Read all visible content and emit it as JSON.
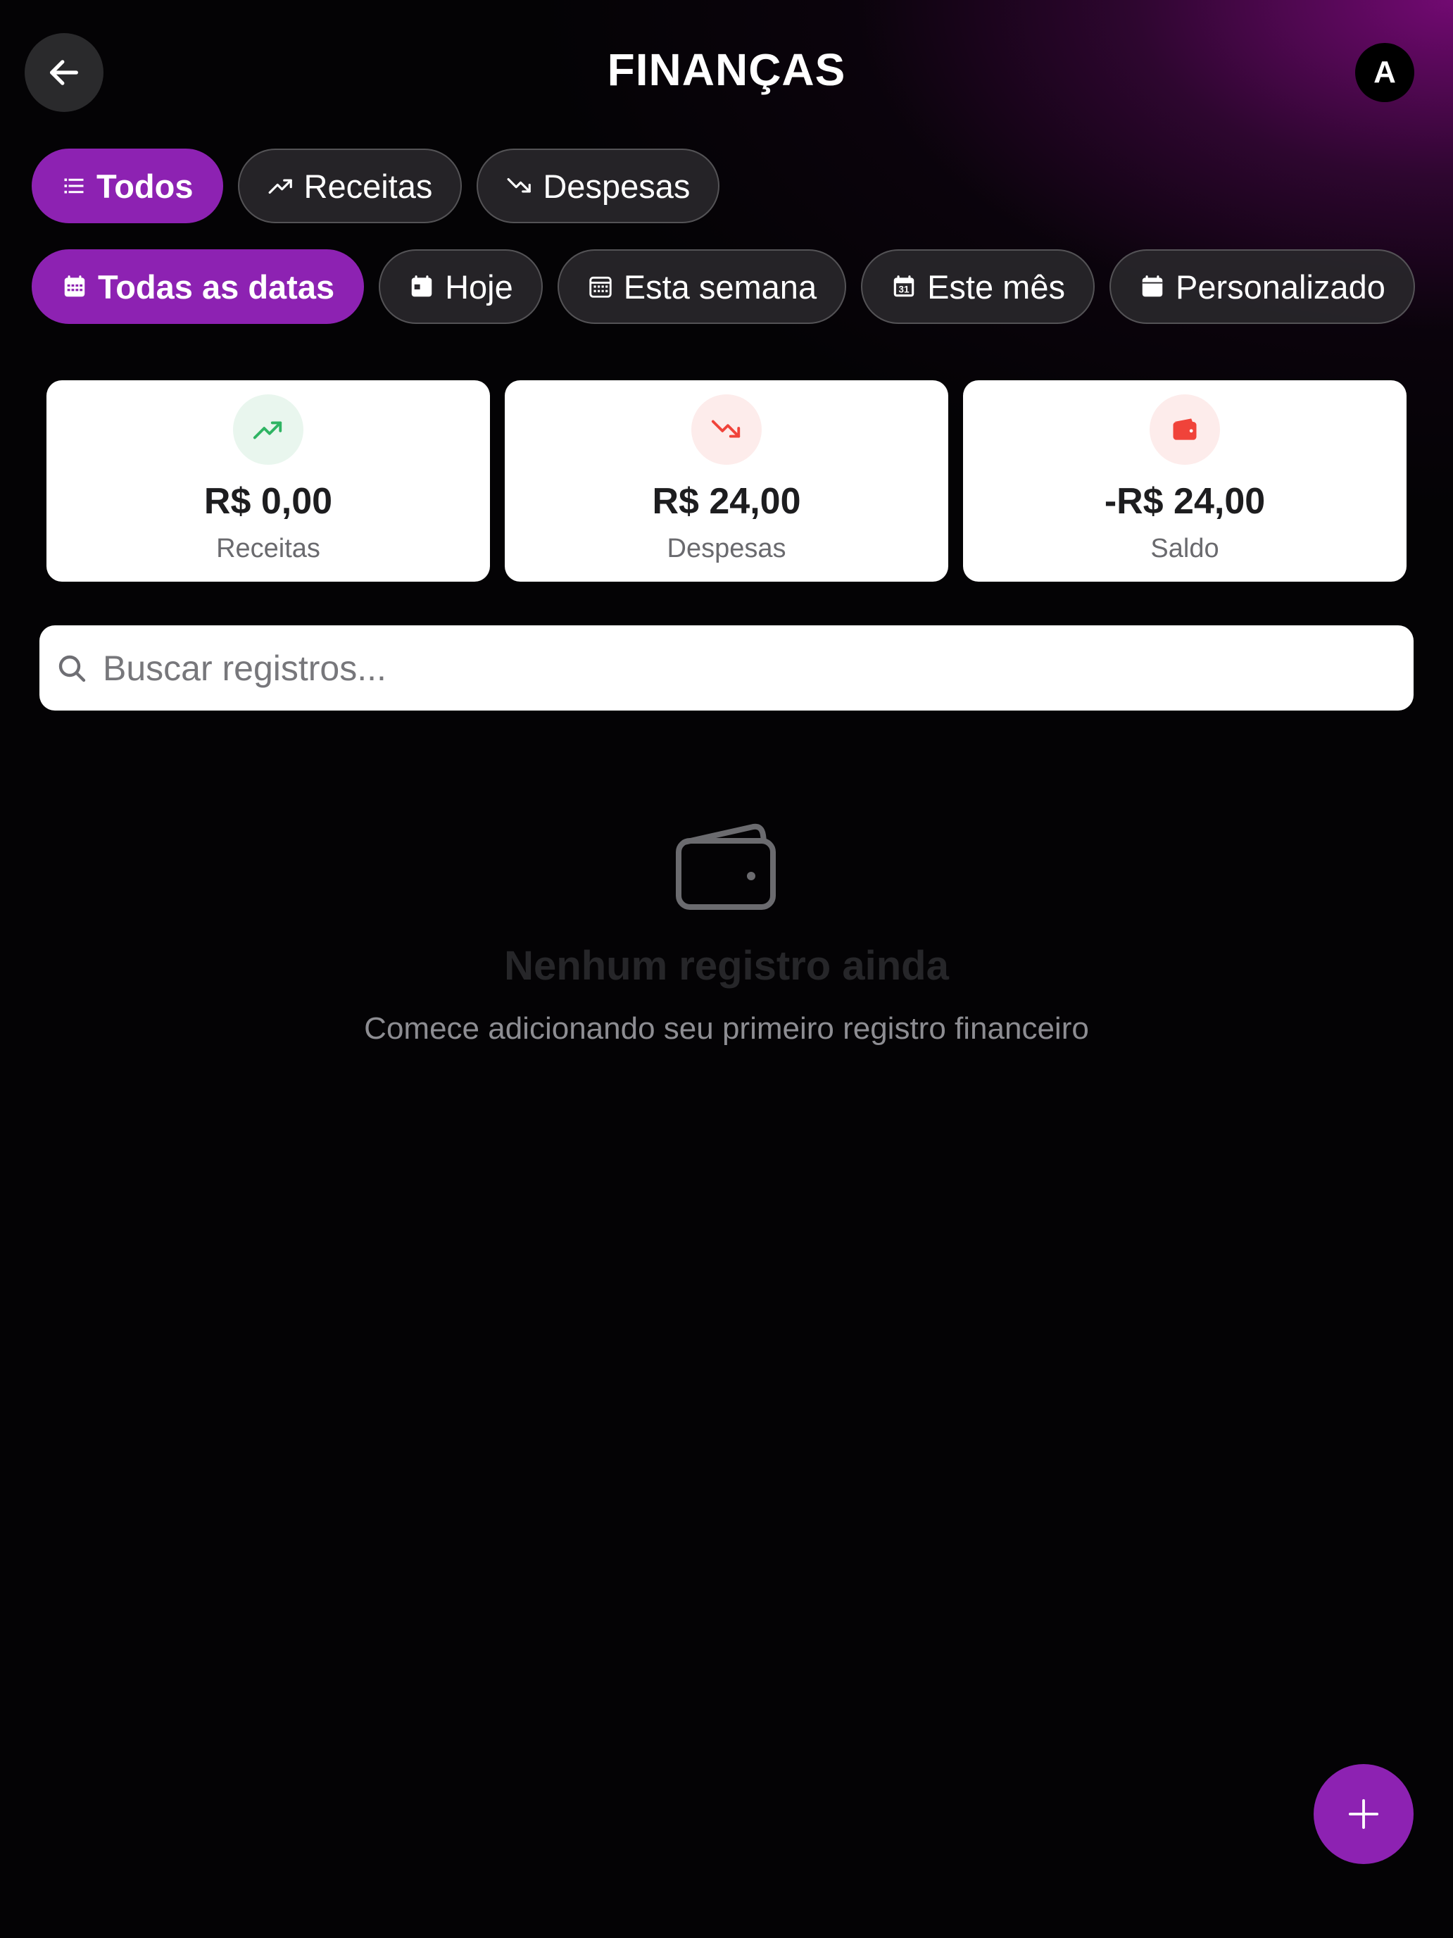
{
  "header": {
    "title": "FINANÇAS",
    "avatar_initial": "A"
  },
  "type_filters": [
    {
      "label": "Todos",
      "icon": "list-icon",
      "active": true
    },
    {
      "label": "Receitas",
      "icon": "trending-up-icon",
      "active": false
    },
    {
      "label": "Despesas",
      "icon": "trending-down-icon",
      "active": false
    }
  ],
  "date_filters": [
    {
      "label": "Todas as datas",
      "icon": "calendar-grid-icon",
      "active": true
    },
    {
      "label": "Hoje",
      "icon": "calendar-today-icon",
      "active": false
    },
    {
      "label": "Esta semana",
      "icon": "calendar-week-icon",
      "active": false
    },
    {
      "label": "Este mês",
      "icon": "calendar-month-icon",
      "active": false
    },
    {
      "label": "Personalizado",
      "icon": "calendar-custom-icon",
      "active": false
    }
  ],
  "summary": {
    "income": {
      "amount": "R$ 0,00",
      "label": "Receitas",
      "icon": "trending-up-icon",
      "color": "#2fb463",
      "bg": "#e9f6ee"
    },
    "expenses": {
      "amount": "R$ 24,00",
      "label": "Despesas",
      "icon": "trending-down-icon",
      "color": "#f0433a",
      "bg": "#fdeceb"
    },
    "balance": {
      "amount": "-R$ 24,00",
      "label": "Saldo",
      "icon": "wallet-icon",
      "color": "#f0433a",
      "bg": "#fdeceb"
    }
  },
  "search": {
    "placeholder": "Buscar registros..."
  },
  "empty_state": {
    "icon": "wallet-icon",
    "title": "Nenhum registro ainda",
    "subtitle": "Comece adicionando seu primeiro registro financeiro"
  },
  "fab": {
    "icon": "plus-icon"
  },
  "colors": {
    "accent": "#8d22b2",
    "background": "#040305",
    "glow": "#780a78"
  }
}
